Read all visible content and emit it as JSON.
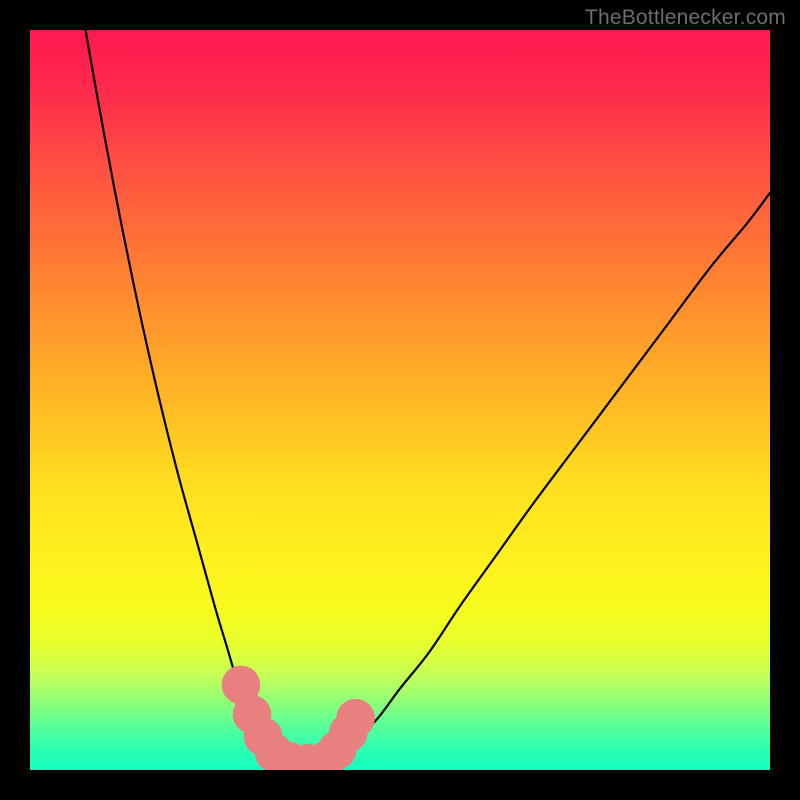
{
  "watermark": "TheBottlenecker.com",
  "colors": {
    "curve_stroke": "#000000",
    "marker_fill": "#e98080",
    "marker_stroke": "#e17a7a",
    "frame": "#000000"
  },
  "chart_data": {
    "type": "line",
    "title": "",
    "xlabel": "",
    "ylabel": "",
    "xlim": [
      0,
      100
    ],
    "ylim": [
      0,
      100
    ],
    "series": [
      {
        "name": "left-branch",
        "x": [
          7.5,
          10,
          12.5,
          15,
          17.5,
          20,
          22.5,
          25,
          26.5,
          28,
          29.5,
          31,
          32.5,
          34,
          35
        ],
        "values": [
          100,
          86,
          73,
          61,
          50,
          40,
          31,
          22,
          17,
          12,
          8,
          5,
          3,
          1.5,
          0.8
        ]
      },
      {
        "name": "right-branch",
        "x": [
          40,
          42,
          44,
          47,
          50,
          54,
          58,
          63,
          68,
          74,
          80,
          86,
          92,
          97,
          100
        ],
        "values": [
          1.0,
          2,
          4,
          7,
          11,
          16,
          22,
          29,
          36,
          44,
          52,
          60,
          68,
          74,
          78
        ]
      }
    ],
    "floor_segment": {
      "x0": 35,
      "x1": 40,
      "y": 0.8
    },
    "markers": [
      {
        "x": 28.5,
        "y": 11.5,
        "r": 2.0
      },
      {
        "x": 30.0,
        "y": 7.5,
        "r": 2.0
      },
      {
        "x": 31.5,
        "y": 4.5,
        "r": 2.0
      },
      {
        "x": 33.0,
        "y": 2.3,
        "r": 2.0
      },
      {
        "x": 35.0,
        "y": 1.2,
        "r": 2.0
      },
      {
        "x": 37.5,
        "y": 0.9,
        "r": 2.0
      },
      {
        "x": 40.0,
        "y": 1.3,
        "r": 2.0
      },
      {
        "x": 41.5,
        "y": 2.7,
        "r": 2.0
      },
      {
        "x": 43.0,
        "y": 5.0,
        "r": 2.0
      },
      {
        "x": 44.0,
        "y": 7.0,
        "r": 2.0
      }
    ]
  }
}
